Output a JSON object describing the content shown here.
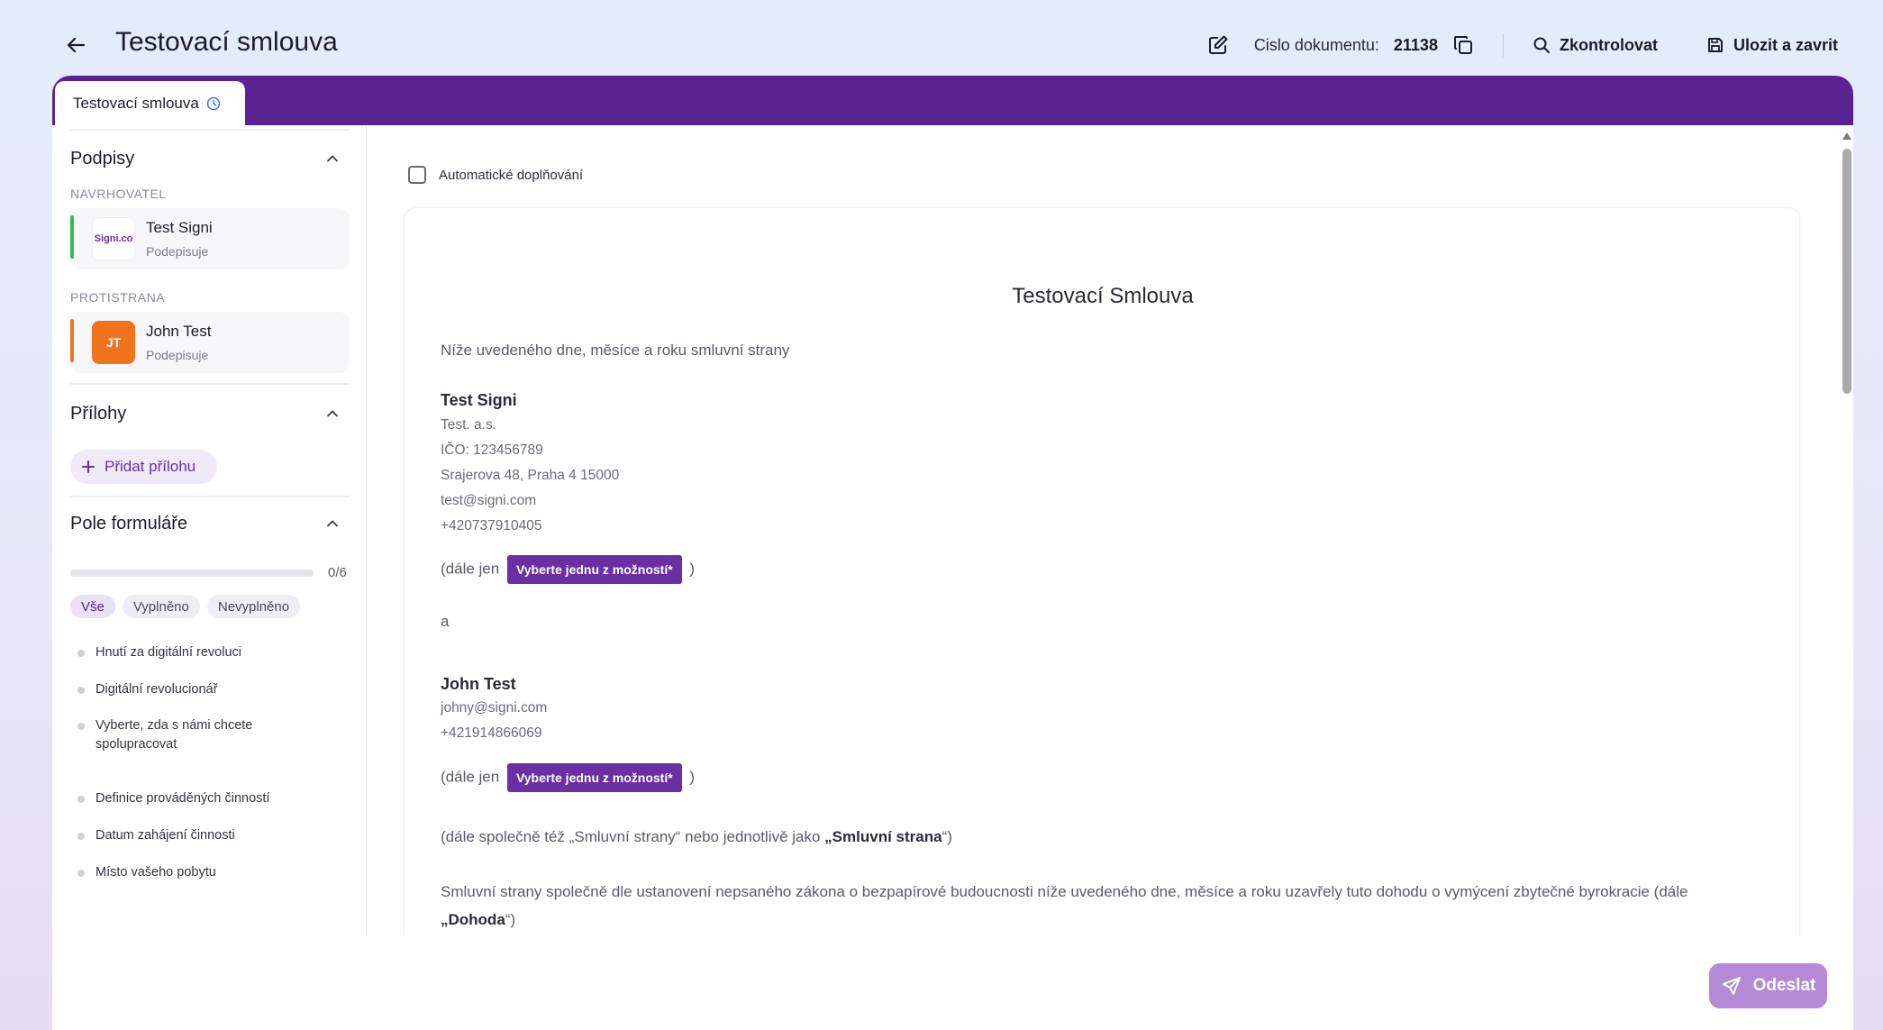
{
  "header": {
    "title": "Testovací smlouva",
    "doc_number_label": "Cislo dokumentu:",
    "doc_number_value": "21138",
    "check_label": "Zkontrolovat",
    "save_close_label": "Ulozit a zavrit"
  },
  "tabs": [
    {
      "label": "Testovací smlouva",
      "active": true
    }
  ],
  "sidebar": {
    "signatures": {
      "title": "Podpisy",
      "proposer_caption": "NAVRHOVATEL",
      "proposer": {
        "name": "Test Signi",
        "status": "Podepisuje",
        "avatar_text": "Signi.co",
        "color": "#2fbf4f"
      },
      "counterparty_caption": "PROTISTRANA",
      "counterparty": {
        "name": "John Test",
        "status": "Podepisuje",
        "avatar_text": "JT",
        "color": "#f2731d"
      }
    },
    "attachments": {
      "title": "Přílohy",
      "add_label": "Přidat přílohu"
    },
    "form_fields": {
      "title": "Pole formuláře",
      "progress_text": "0/6",
      "progress_fraction": 0,
      "filters": [
        "Vše",
        "Vyplněno",
        "Nevyplněno"
      ],
      "items": [
        "Hnutí za digitální revoluci",
        "Digitální revolucionář",
        "Vyberte, zda s námi chcete spolupracovat",
        "Definice prováděných činností",
        "Datum zahájení činnosti",
        "Místo vašeho pobytu"
      ]
    }
  },
  "content": {
    "auto_fill_label": "Automatické doplňování",
    "doc_title": "Testovací Smlouva",
    "intro": "Níže uvedeného dne, měsíce a roku smluvní strany",
    "party1": {
      "name": "Test Signi",
      "lines": [
        "Test. a.s.",
        "IČO: 123456789",
        "Srajerova 48, Praha 4 15000",
        "test@signi.com",
        "+420737910405"
      ]
    },
    "dale_jen": "(dále jen",
    "select_label": "Vyberte jednu z možností*",
    "close_paren": ")",
    "and": "a",
    "party2": {
      "name": "John Test",
      "lines": [
        "johny@signi.com",
        "+421914866069"
      ]
    },
    "parties_line_start": "(dále společně též „Smluvní strany“ nebo jednotlivě jako ",
    "parties_line_bold": "„Smluvní strana",
    "parties_line_end": "“)",
    "agreement_line1": "Smluvní strany společně dle ustanovení nepsaného zákona o bezpapírové budoucnosti níže uvedeného dne, měsíce a roku uzavřely tuto dohodu o vymýcení zbytečné byrokracie (dále",
    "agreement_line2_bold": "„Dohoda",
    "agreement_line2_end": "“)"
  },
  "footer": {
    "send_label": "Odeslat"
  },
  "colors": {
    "brand": "#5b2392",
    "accent_line": "#3d7ad8"
  }
}
